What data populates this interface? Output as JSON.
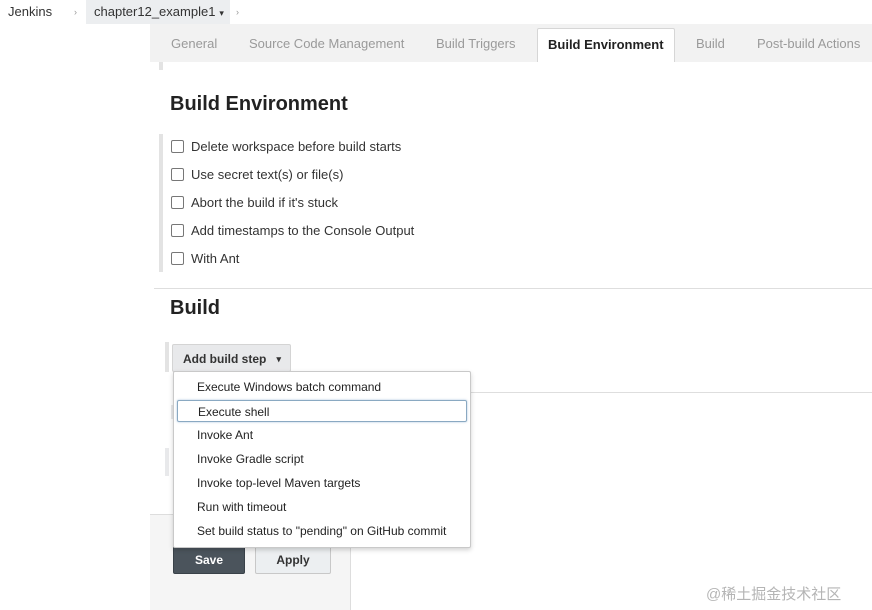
{
  "breadcrumb": {
    "root": "Jenkins",
    "separator": "›",
    "job": "chapter12_example1",
    "job_menu": "▾"
  },
  "tabs": [
    {
      "label": "General",
      "active": false
    },
    {
      "label": "Source Code Management",
      "active": false
    },
    {
      "label": "Build Triggers",
      "active": false
    },
    {
      "label": "Build Environment",
      "active": true
    },
    {
      "label": "Build",
      "active": false
    },
    {
      "label": "Post-build Actions",
      "active": false
    }
  ],
  "build_environment": {
    "title": "Build Environment",
    "options": [
      {
        "label": "Delete workspace before build starts",
        "checked": false
      },
      {
        "label": "Use secret text(s) or file(s)",
        "checked": false
      },
      {
        "label": "Abort the build if it's stuck",
        "checked": false
      },
      {
        "label": "Add timestamps to the Console Output",
        "checked": false
      },
      {
        "label": "With Ant",
        "checked": false
      }
    ]
  },
  "build": {
    "title": "Build",
    "add_step_label": "Add build step",
    "add_step_caret": "▾"
  },
  "build_step_menu": {
    "items": [
      {
        "label": "Execute Windows batch command",
        "hovered": false
      },
      {
        "label": "Execute shell",
        "hovered": true
      },
      {
        "label": "Invoke Ant",
        "hovered": false
      },
      {
        "label": "Invoke Gradle script",
        "hovered": false
      },
      {
        "label": "Invoke top-level Maven targets",
        "hovered": false
      },
      {
        "label": "Run with timeout",
        "hovered": false
      },
      {
        "label": "Set build status to \"pending\" on GitHub commit",
        "hovered": false
      }
    ]
  },
  "actions": {
    "save_label": "Save",
    "apply_label": "Apply"
  },
  "watermark": "@稀土掘金技术社区",
  "colors": {
    "save_button": "#4b545c",
    "tab_bar": "#f2f2f2",
    "menu_hover_border": "#8aa9c2"
  }
}
